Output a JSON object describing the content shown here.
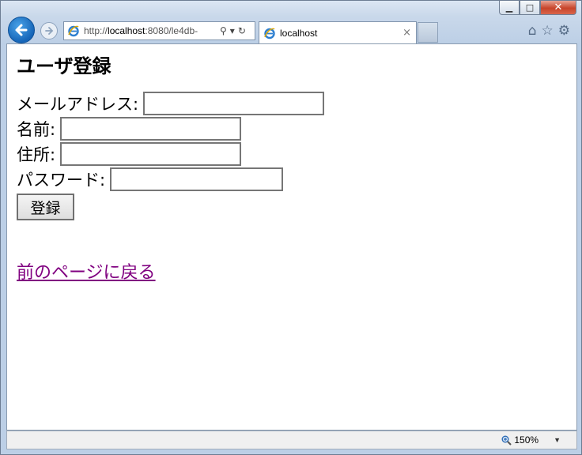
{
  "window": {
    "caption": {
      "minimize": "▁",
      "maximize": "□",
      "close": "✕"
    }
  },
  "nav": {
    "address_prefix": "http://",
    "address_host": "localhost",
    "address_rest": ":8080/le4db-",
    "search_icon": "⚲",
    "dropdown_icon": "▾",
    "refresh_icon": "↻"
  },
  "tab": {
    "title": "localhost",
    "close": "×"
  },
  "toolbar": {
    "home_icon": "⌂",
    "favorites_icon": "☆",
    "tools_icon": "⚙"
  },
  "page": {
    "title": "ユーザ登録",
    "fields": [
      {
        "label": "メールアドレス:",
        "value": ""
      },
      {
        "label": "名前:",
        "value": ""
      },
      {
        "label": "住所:",
        "value": ""
      },
      {
        "label": "パスワード:",
        "value": ""
      }
    ],
    "submit_label": "登録",
    "back_link": "前のページに戻る"
  },
  "status": {
    "zoom": "150%",
    "zoom_arrow": "▼"
  },
  "colors": {
    "link_visited": "#800080",
    "back_button": "#1565b8"
  }
}
